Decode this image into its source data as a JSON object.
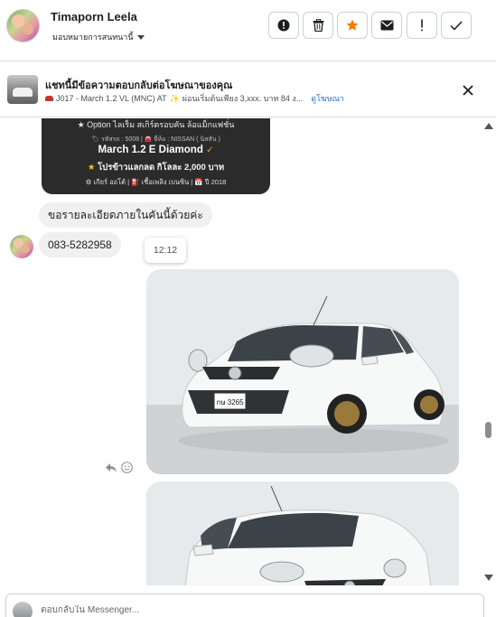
{
  "header": {
    "contact_name": "Timaporn Leela",
    "assign_label": "มอบหมายการสนทนานี้",
    "actions": [
      {
        "name": "spam-alert",
        "icon": "exclamation-circle-icon"
      },
      {
        "name": "delete",
        "icon": "trash-icon"
      },
      {
        "name": "star",
        "icon": "star-icon",
        "color": "#f57c00"
      },
      {
        "name": "mark-unread",
        "icon": "envelope-icon"
      },
      {
        "name": "follow-up",
        "icon": "exclamation-icon"
      },
      {
        "name": "done",
        "icon": "checkmark-icon"
      }
    ]
  },
  "ad_bar": {
    "title": "แชทนี้มีข้อความตอบกลับต่อโฆษณาของคุณ",
    "subtitle": "J017 - March 1.2 VL (MNC) AT",
    "subtitle_detail": "ผ่อนเริ่มต้นเพียง 3,xxx. บาท 84 ง...",
    "link_label": "ดูโฆษณา"
  },
  "promo_card": {
    "line1": "★ Option ไลเร็ม สเกิร์ตรอบคัน ล้อแม็กแฟชั่น",
    "line2": "🏷 รหัสรถ : 5008  |  🚘 ยี่ห้อ : NISSAN ( นิสสัน )",
    "model": "March 1.2 E Diamond",
    "offer": "โปรข้าวแลกลด กิโลละ 2,000 บาท",
    "specs": "⚙ เกียร์ ออโต้  |  ⛽ เชื้อเพลิง เบนซิน  |  📅 ปี 2018"
  },
  "messages": [
    {
      "text": "ขอรายละเอียดภายในคันนี้ด้วยค่ะ"
    },
    {
      "text": "083-5282958"
    }
  ],
  "timestamp": "12:12",
  "photo_plate": "กษ 3265",
  "composer": {
    "placeholder": "ตอบกลับใน Messenger..."
  }
}
